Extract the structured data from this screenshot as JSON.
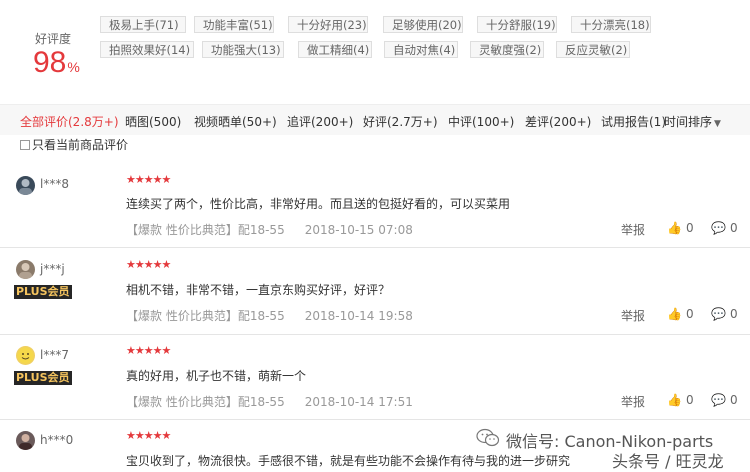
{
  "summary": {
    "rate_label": "好评度",
    "rate_value": "98",
    "rate_unit": "%",
    "tags": [
      "极易上手(71)",
      "功能丰富(51)",
      "十分好用(23)",
      "足够使用(20)",
      "十分舒服(19)",
      "十分漂亮(18)",
      "拍照效果好(14)",
      "功能强大(13)",
      "做工精细(4)",
      "自动对焦(4)",
      "灵敏度强(2)",
      "反应灵敏(2)"
    ]
  },
  "filters": {
    "tabs": [
      "全部评价(2.8万+)",
      "晒图(500)",
      "视频晒单(50+)",
      "追评(200+)",
      "好评(2.7万+)",
      "中评(100+)",
      "差评(200+)",
      "试用报告(1)"
    ],
    "active_index": 0,
    "sort_label": "时间排序",
    "only_current_label": "只看当前商品评价",
    "only_current_checked": false
  },
  "reviews": [
    {
      "user": "l***8",
      "plus": "",
      "stars": "★★★★★",
      "content": "连续买了两个，性价比高，非常好用。而且送的包挺好看的，可以买菜用",
      "tag": "【爆款 性价比典范】",
      "config": "配18-55",
      "date": "2018-10-15 07:08",
      "report": "举报",
      "likes": "0",
      "comments": "0",
      "avatar_color": "#3a4a5a"
    },
    {
      "user": "j***j",
      "plus": "PLUS会员",
      "stars": "★★★★★",
      "content": "相机不错，非常不错，一直京东购买好评，好评？",
      "tag": "【爆款 性价比典范】",
      "config": "配18-55",
      "date": "2018-10-14 19:58",
      "report": "举报",
      "likes": "0",
      "comments": "0",
      "avatar_color": "#8a7a6a"
    },
    {
      "user": "l***7",
      "plus": "PLUS会员",
      "stars": "★★★★★",
      "content": "真的好用，机子也不错，萌新一个",
      "tag": "【爆款 性价比典范】",
      "config": "配18-55",
      "date": "2018-10-14 17:51",
      "report": "举报",
      "likes": "0",
      "comments": "0",
      "avatar_color": "#f0d060"
    },
    {
      "user": "h***0",
      "plus": "",
      "stars": "★★★★★",
      "content": "宝贝收到了，物流很快。手感很不错，就是有些功能不会操作有待与我的进一步研究",
      "tag": "",
      "config": "",
      "date": "",
      "report": "",
      "likes": "",
      "comments": "",
      "avatar_color": "#6a5a5a"
    }
  ],
  "watermark": {
    "wechat": "微信号: Canon-Nikon-parts",
    "toutiao": "头条号 / 旺灵龙"
  }
}
